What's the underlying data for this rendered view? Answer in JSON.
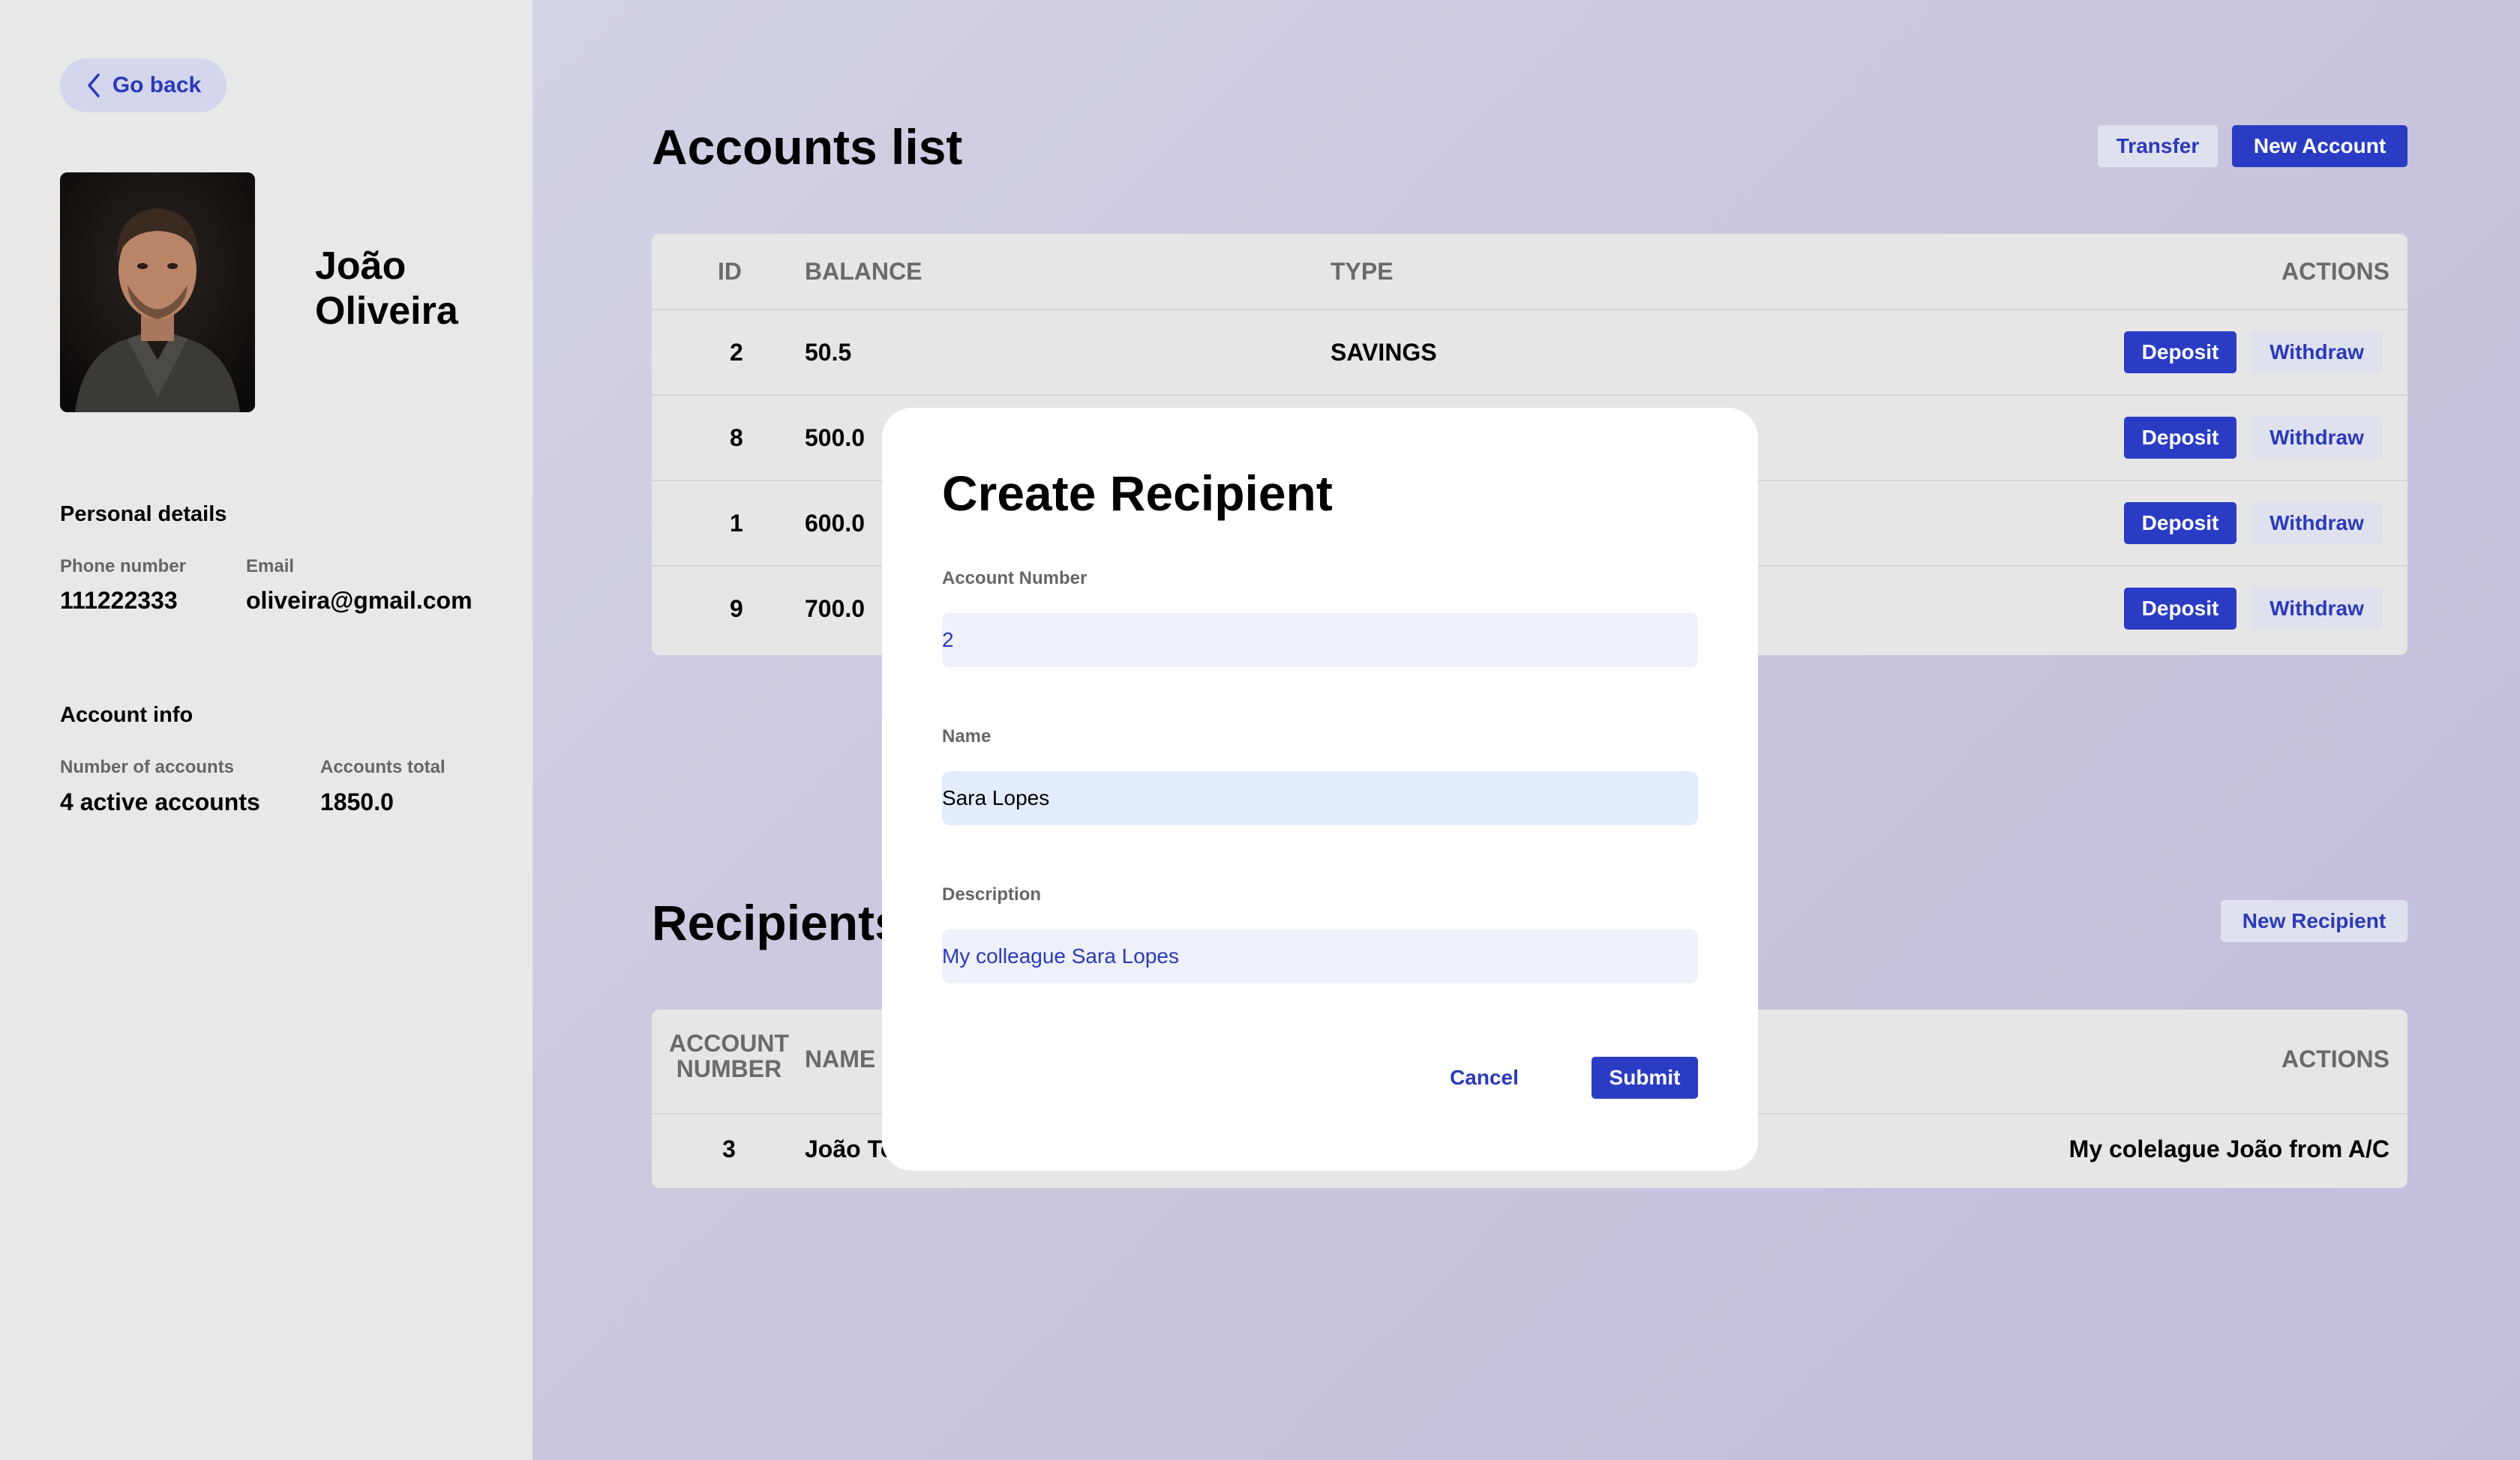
{
  "sidebar": {
    "back_label": "Go back",
    "user": {
      "first_name": "João",
      "last_name": "Oliveira"
    },
    "personal": {
      "title": "Personal details",
      "phone_label": "Phone number",
      "phone": "111222333",
      "email_label": "Email",
      "email": "oliveira@gmail.com"
    },
    "account_info": {
      "title": "Account info",
      "count_label": "Number of accounts",
      "count": "4 active accounts",
      "total_label": "Accounts total",
      "total": "1850.0"
    }
  },
  "accounts": {
    "title": "Accounts list",
    "transfer_label": "Transfer",
    "new_account_label": "New Account",
    "columns": [
      "ID",
      "BALANCE",
      "TYPE",
      "ACTIONS"
    ],
    "rows": [
      {
        "id": "2",
        "balance": "50.5",
        "type": "SAVINGS"
      },
      {
        "id": "8",
        "balance": "500.0",
        "type": ""
      },
      {
        "id": "1",
        "balance": "600.0",
        "type": ""
      },
      {
        "id": "9",
        "balance": "700.0",
        "type": ""
      }
    ],
    "deposit_label": "Deposit",
    "withdraw_label": "Withdraw"
  },
  "recipients": {
    "title": "Recipients",
    "new_label": "New Recipient",
    "columns": {
      "account_line1": "ACCOUNT",
      "account_line2": "NUMBER",
      "name": "NAME",
      "actions": "ACTIONS"
    },
    "rows": [
      {
        "account": "3",
        "name": "João To",
        "description": "My colelague João from A/C"
      }
    ]
  },
  "modal": {
    "title": "Create Recipient",
    "account_label": "Account Number",
    "account_value": "2",
    "name_label": "Name",
    "name_value": "Sara Lopes",
    "description_label": "Description",
    "description_value": "My colleague Sara Lopes",
    "cancel_label": "Cancel",
    "submit_label": "Submit"
  },
  "colors": {
    "accent": "#2b3cc4",
    "accent_text": "#2b3ab8",
    "light_button": "#dfe1ef"
  }
}
